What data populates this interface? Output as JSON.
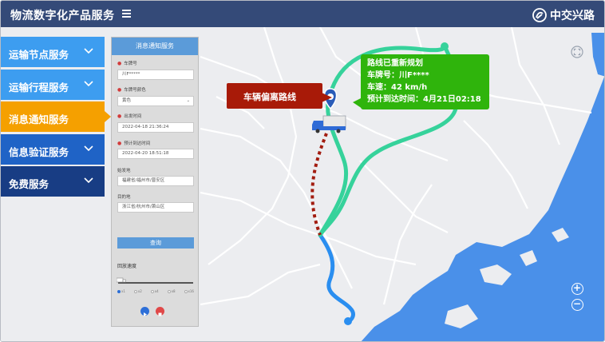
{
  "header": {
    "title": "物流数字化产品服务",
    "logo_text": "中交兴路",
    "background": "#344a78"
  },
  "sidebar": {
    "items": [
      {
        "label": "运输节点服务",
        "color": "#3d9df0",
        "active": false
      },
      {
        "label": "运输行程服务",
        "color": "#3d9df0",
        "active": false
      },
      {
        "label": "消息通知服务",
        "color": "#f5a000",
        "active": true
      },
      {
        "label": "信息验证服务",
        "color": "#1f63c6",
        "active": false
      },
      {
        "label": "免费服务",
        "color": "#183d84",
        "active": false
      }
    ]
  },
  "panel": {
    "title": "消息通知服务",
    "fields": {
      "plate_label": "车牌号",
      "plate_value": "川F*****",
      "color_label": "车牌号颜色",
      "color_value": "黄色",
      "depart_label": "出发时间",
      "depart_value": "2022-04-18 21:36:24",
      "arrive_label": "预计到达时间",
      "arrive_value": "2022-04-20 18:51:18",
      "origin_label": "始发地",
      "origin_value": "福建省/福州市/晋安区",
      "dest_label": "目的地",
      "dest_value": "浙江省/杭州市/萧山区"
    },
    "query_label": "查询",
    "speed_label": "回放速度",
    "speed_ticks": [
      "x1",
      "x2",
      "x4",
      "x8",
      "x16"
    ],
    "speed_selected": "x1"
  },
  "map": {
    "deviation_callout": "车辆偏离路线",
    "info_callout": {
      "line1": "路线已重新规划",
      "line2": "车牌号：川F****",
      "line3": "车速：42 km/h",
      "line4": "预计到达时间：4月21日02:18"
    },
    "colors": {
      "land": "#ecedf0",
      "sea": "#4a90e9",
      "original_route": "#2a8ef0",
      "new_route": "#36d29b",
      "deviation": "#a21c10",
      "callout_red": "#a81a08",
      "callout_green": "#2fb40c"
    },
    "controls": {
      "zoom_in": "+",
      "zoom_out": "−"
    }
  }
}
